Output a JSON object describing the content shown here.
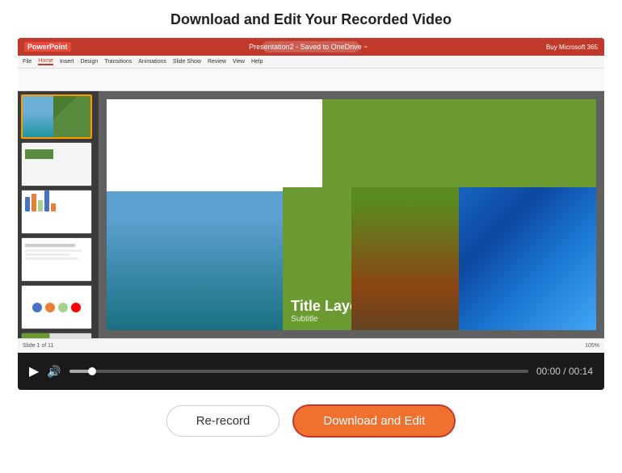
{
  "page": {
    "title": "Download and Edit Your Recorded Video"
  },
  "video": {
    "current_time": "00:00",
    "duration": "00:14",
    "time_display": "00:00 / 00:14",
    "progress_percent": 5
  },
  "ppt": {
    "logo": "PowerPoint",
    "title": "Presentation2 - Saved to OneDrive ~",
    "tabs": [
      "File",
      "Home",
      "Insert",
      "Design",
      "Transitions",
      "Animations",
      "Slide Show",
      "Review",
      "View",
      "Help"
    ],
    "slide_title": "Title Layout",
    "slide_subtitle": "Subtitle",
    "status": "Slide 1 of 11",
    "zoom": "105%"
  },
  "buttons": {
    "rerecord": "Re-record",
    "download_edit": "Download and Edit"
  },
  "icons": {
    "play": "▶",
    "volume": "🔊",
    "progress_knob": "●"
  }
}
